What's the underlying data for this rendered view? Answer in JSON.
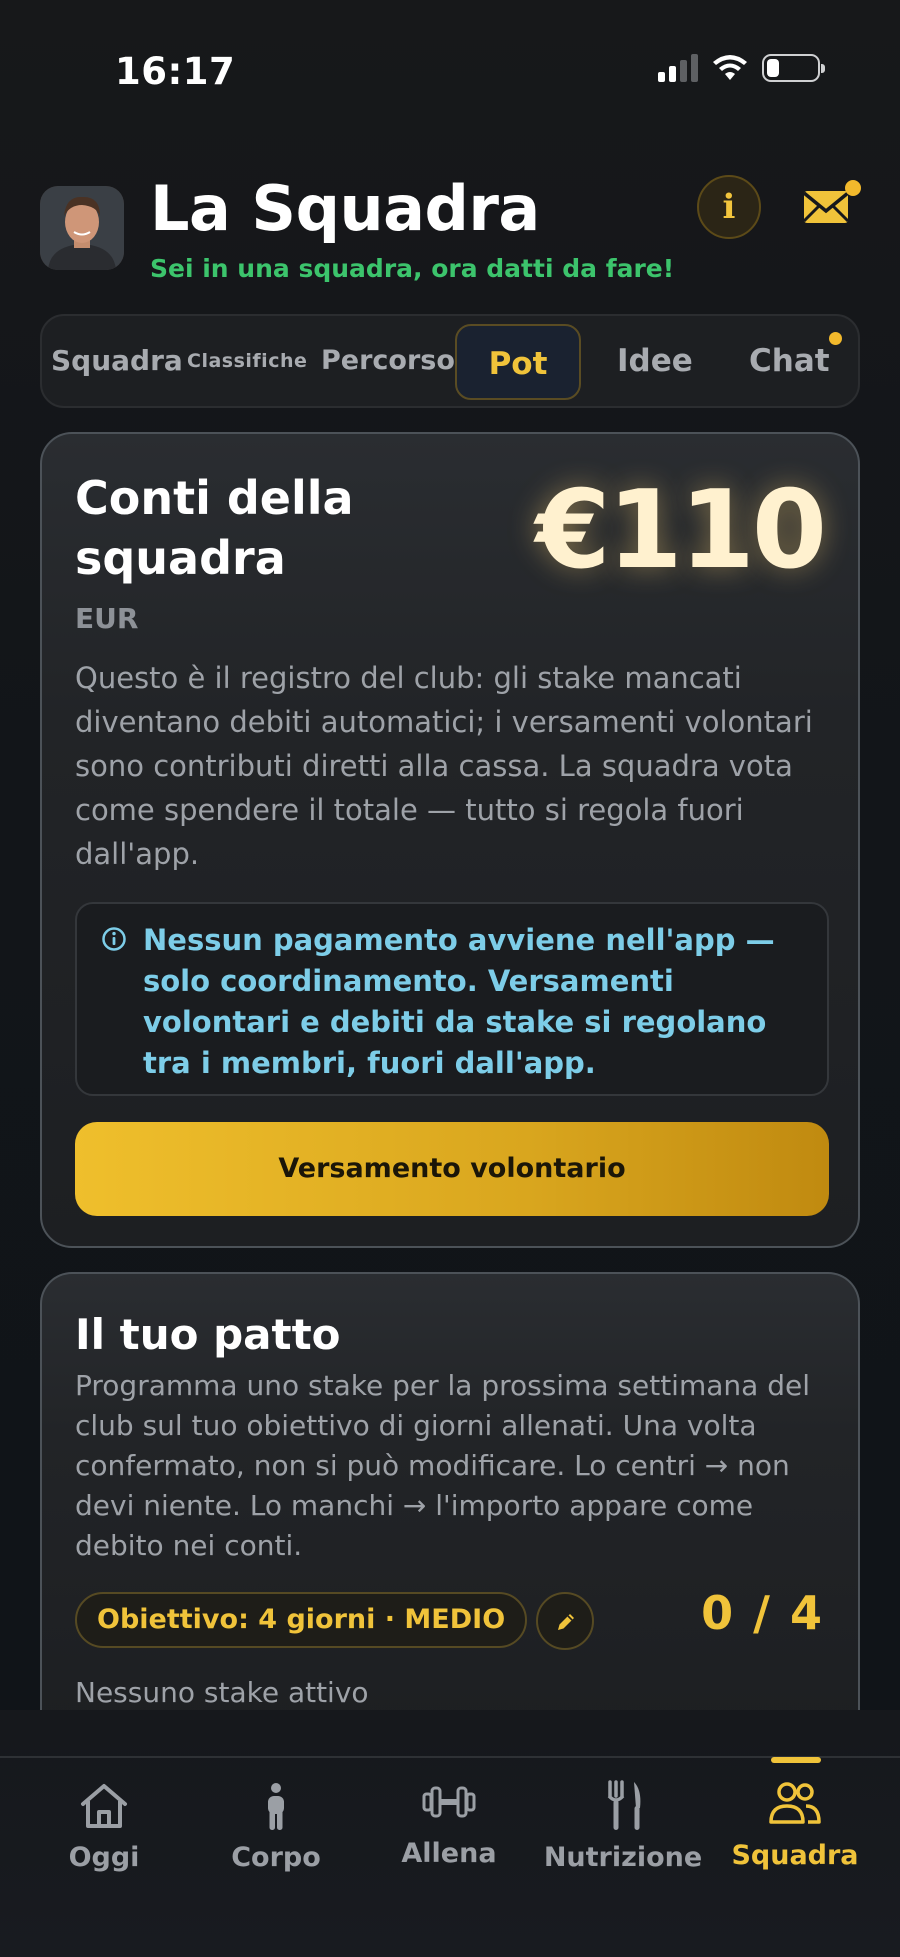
{
  "status_bar": {
    "time": "16:17"
  },
  "header": {
    "title": "La Squadra",
    "subtitle": "Sei in una squadra, ora datti da fare!",
    "info_label": "i"
  },
  "tabs": [
    {
      "label": "Squadra",
      "active": false
    },
    {
      "label": "Classifiche",
      "active": false
    },
    {
      "label": "Percorso",
      "active": false
    },
    {
      "label": "Pot",
      "active": true
    },
    {
      "label": "Idee",
      "active": false
    },
    {
      "label": "Chat",
      "active": false,
      "has_badge": true
    }
  ],
  "pot": {
    "title": "Conti della squadra",
    "amount": "€110",
    "currency": "EUR",
    "description": "Questo è il registro del club: gli stake mancati diventano debiti automatici; i versamenti volontari sono contributi diretti alla cassa. La squadra vota come spendere il totale — tutto si regola fuori dall'app.",
    "notice": "Nessun pagamento avviene nell'app — solo coordinamento. Versamenti volontari e debiti da stake si regolano tra i membri, fuori dall'app.",
    "button_label": "Versamento volontario"
  },
  "pact": {
    "title": "Il tuo patto",
    "description": "Programma uno stake per la prossima settimana del club sul tuo obiettivo di giorni allenati. Una volta confermato, non si può modificare. Lo centri → non devi niente. Lo manchi → l'importo appare come debito nei conti.",
    "goal_label": "Obiettivo: 4 giorni · MEDIO",
    "progress": "0 / 4",
    "stake_status": "Nessuno stake attivo"
  },
  "bottom_nav": [
    {
      "label": "Oggi",
      "icon": "home-icon",
      "active": false
    },
    {
      "label": "Corpo",
      "icon": "person-icon",
      "active": false
    },
    {
      "label": "Allena",
      "icon": "dumbbell-icon",
      "active": false
    },
    {
      "label": "Nutrizione",
      "icon": "fork-knife-icon",
      "active": false
    },
    {
      "label": "Squadra",
      "icon": "team-icon",
      "active": true
    }
  ],
  "colors": {
    "accent": "#f0c33a",
    "subtitle_green": "#3cc46c",
    "notice_blue": "#7dcde8"
  }
}
